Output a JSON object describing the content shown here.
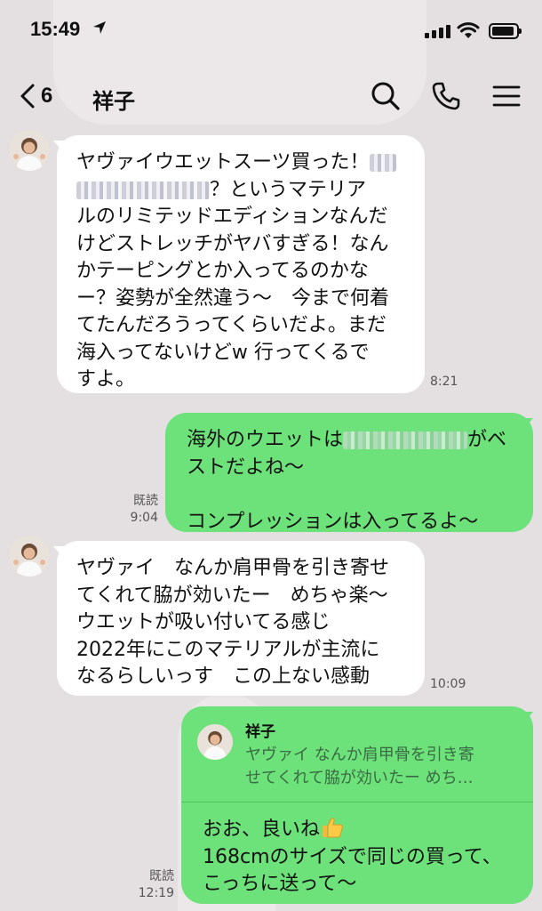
{
  "status_bar": {
    "time": "15:49"
  },
  "header": {
    "back_count": "6",
    "title": "祥子"
  },
  "messages": [
    {
      "lines": [
        "ヤヴァイウエットスーツ買った！",
        "？というマテリア",
        "ルのリミテッドエディションなんだ",
        "けどストレッチがヤバすぎる！なん",
        "かテーピングとか入ってるのかな",
        "ー？姿勢が全然違う〜　今まで何着",
        "てたんだろうってくらいだよ。まだ",
        "海入ってないけどw 行ってくるで",
        "すよ。"
      ],
      "time": "8:21"
    },
    {
      "line1a": "海外のウエットは",
      "line1b": "がベ",
      "line2": "ストだよね〜",
      "line3": "コンプレッションは入ってるよ〜",
      "read": "既読",
      "time": "9:04"
    },
    {
      "lines": [
        "ヤヴァイ　なんか肩甲骨を引き寄せ",
        "てくれて脇が効いたー　めちゃ楽〜",
        "ウエットが吸い付いてる感じ",
        "2022年にこのマテリアルが主流に",
        "なるらしいっす　この上ない感動"
      ],
      "time": "10:09"
    },
    {
      "reply_name": "祥子",
      "reply_line1": "ヤヴァイ なんか肩甲骨を引き寄",
      "reply_line2": "せてくれて脇が効いたー めち…",
      "line1": "おお、良いね",
      "line2": "168cmのサイズで同じの買って、",
      "line3": "こっちに送って〜",
      "read": "既読",
      "time": "12:19"
    }
  ],
  "icons": {
    "header": [
      "chevron-left-icon",
      "search-icon",
      "phone-icon",
      "menu-icon"
    ],
    "status": [
      "location-arrow-icon",
      "signal-icon",
      "wifi-icon",
      "battery-icon"
    ],
    "inline": [
      "thumbs-up-icon"
    ]
  },
  "colors": {
    "incoming_bubble": "#ffffff",
    "outgoing_bubble": "#6de27a",
    "background": "#e4dfe1"
  }
}
